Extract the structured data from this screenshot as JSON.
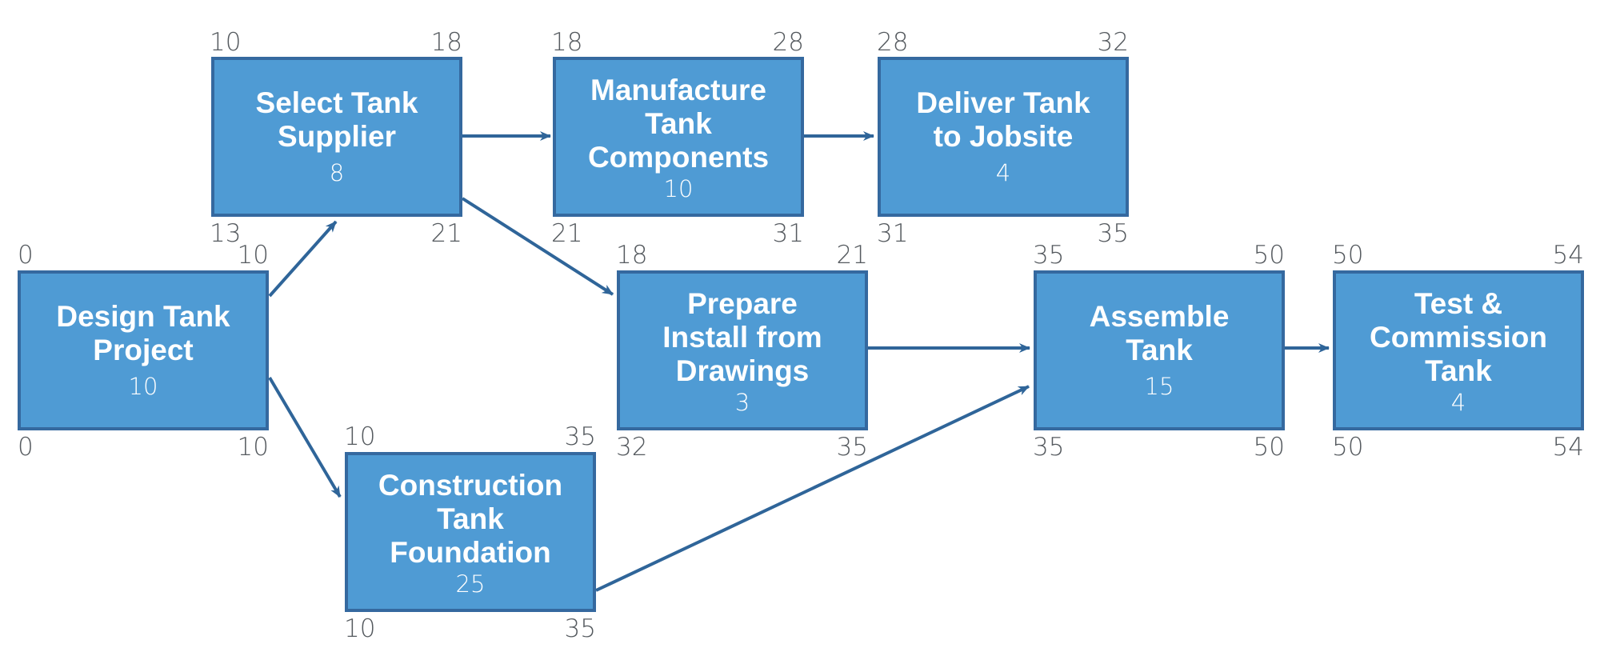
{
  "colors": {
    "node_fill": "#4f9bd4",
    "node_border": "#35699f",
    "arrow": "#2f6599",
    "label_text": "#555a5f",
    "node_text": "#ffffff"
  },
  "nodes": [
    {
      "id": "design",
      "title": "Design Tank\nProject",
      "duration": "10",
      "es": "0",
      "ef": "10",
      "ls": "0",
      "lf": "10"
    },
    {
      "id": "select",
      "title": "Select Tank\nSupplier",
      "duration": "8",
      "es": "10",
      "ef": "18",
      "ls": "13",
      "lf": "21"
    },
    {
      "id": "manufacture",
      "title": "Manufacture\nTank\nComponents",
      "duration": "10",
      "es": "18",
      "ef": "28",
      "ls": "21",
      "lf": "31"
    },
    {
      "id": "deliver",
      "title": "Deliver Tank\nto Jobsite",
      "duration": "4",
      "es": "28",
      "ef": "32",
      "ls": "31",
      "lf": "35"
    },
    {
      "id": "prepare",
      "title": "Prepare\nInstall from\nDrawings",
      "duration": "3",
      "es": "18",
      "ef": "21",
      "ls": "32",
      "lf": "35"
    },
    {
      "id": "construction",
      "title": "Construction\nTank\nFoundation",
      "duration": "25",
      "es": "10",
      "ef": "35",
      "ls": "10",
      "lf": "35"
    },
    {
      "id": "assemble",
      "title": "Assemble\nTank",
      "duration": "15",
      "es": "35",
      "ef": "50",
      "ls": "35",
      "lf": "50"
    },
    {
      "id": "test",
      "title": "Test &\nCommission\nTank",
      "duration": "4",
      "es": "50",
      "ef": "54",
      "ls": "50",
      "lf": "54"
    }
  ],
  "edges": [
    {
      "from": "design",
      "to": "select"
    },
    {
      "from": "design",
      "to": "construction"
    },
    {
      "from": "select",
      "to": "manufacture"
    },
    {
      "from": "select",
      "to": "prepare"
    },
    {
      "from": "manufacture",
      "to": "deliver"
    },
    {
      "from": "prepare",
      "to": "assemble"
    },
    {
      "from": "construction",
      "to": "assemble"
    },
    {
      "from": "assemble",
      "to": "test"
    }
  ]
}
